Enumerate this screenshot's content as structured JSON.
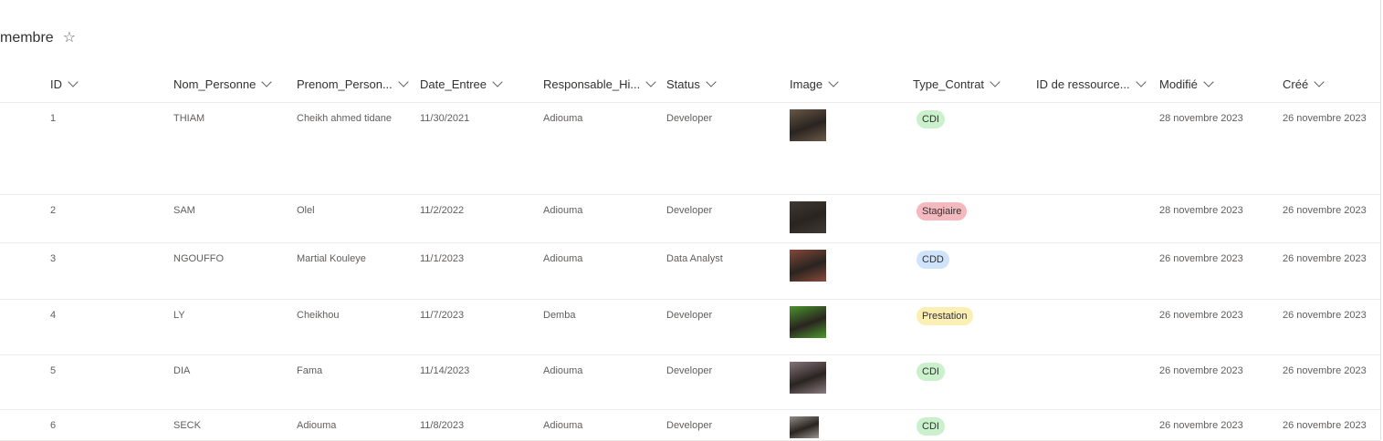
{
  "list": {
    "title": "membre",
    "favorite_icon": "star-outline-icon"
  },
  "columns": [
    {
      "key": "id",
      "label": "ID"
    },
    {
      "key": "nom",
      "label": "Nom_Personne"
    },
    {
      "key": "prenom",
      "label": "Prenom_Person..."
    },
    {
      "key": "date",
      "label": "Date_Entree"
    },
    {
      "key": "resp",
      "label": "Responsable_Hi..."
    },
    {
      "key": "status",
      "label": "Status"
    },
    {
      "key": "image",
      "label": "Image"
    },
    {
      "key": "contrat",
      "label": "Type_Contrat"
    },
    {
      "key": "ressource",
      "label": "ID de ressource..."
    },
    {
      "key": "modifie",
      "label": "Modifié"
    },
    {
      "key": "cree",
      "label": "Créé"
    }
  ],
  "rows": [
    {
      "id": "1",
      "nom": "THIAM",
      "prenom": "Cheikh ahmed tidane",
      "date": "11/30/2021",
      "resp": "Adiouma",
      "status": "Developer",
      "image": "person-photo-thumbnail",
      "contrat": "CDI",
      "ressource": "",
      "modifie": "28 novembre 2023",
      "cree": "26 novembre 2023"
    },
    {
      "id": "2",
      "nom": "SAM",
      "prenom": "Olel",
      "date": "11/2/2022",
      "resp": "Adiouma",
      "status": "Developer",
      "image": "person-photo-thumbnail",
      "contrat": "Stagiaire",
      "ressource": "",
      "modifie": "28 novembre 2023",
      "cree": "26 novembre 2023"
    },
    {
      "id": "3",
      "nom": "NGOUFFO",
      "prenom": "Martial Kouleye",
      "date": "11/1/2023",
      "resp": "Adiouma",
      "status": "Data Analyst",
      "image": "person-photo-thumbnail",
      "contrat": "CDD",
      "ressource": "",
      "modifie": "26 novembre 2023",
      "cree": "26 novembre 2023"
    },
    {
      "id": "4",
      "nom": "LY",
      "prenom": "Cheikhou",
      "date": "11/7/2023",
      "resp": "Demba",
      "status": "Developer",
      "image": "person-photo-thumbnail",
      "contrat": "Prestation",
      "ressource": "",
      "modifie": "26 novembre 2023",
      "cree": "26 novembre 2023"
    },
    {
      "id": "5",
      "nom": "DIA",
      "prenom": "Fama",
      "date": "11/14/2023",
      "resp": "Adiouma",
      "status": "Developer",
      "image": "person-photo-thumbnail",
      "contrat": "CDI",
      "ressource": "",
      "modifie": "26 novembre 2023",
      "cree": "26 novembre 2023"
    },
    {
      "id": "6",
      "nom": "SECK",
      "prenom": "Adiouma",
      "date": "11/8/2023",
      "resp": "Adiouma",
      "status": "Developer",
      "image": "person-photo-thumbnail",
      "contrat": "CDI",
      "ressource": "",
      "modifie": "26 novembre 2023",
      "cree": "26 novembre 2023"
    }
  ],
  "badge_colors": {
    "CDI": "#caf0cc",
    "Stagiaire": "#f4b8bf",
    "CDD": "#cfe4fa",
    "Prestation": "#fcefb4"
  },
  "thumb_colors": [
    "#6b5a48",
    "#3f3a35",
    "#8a4a3a",
    "#4c9a2e",
    "#8a7a80",
    "#9a9590"
  ]
}
